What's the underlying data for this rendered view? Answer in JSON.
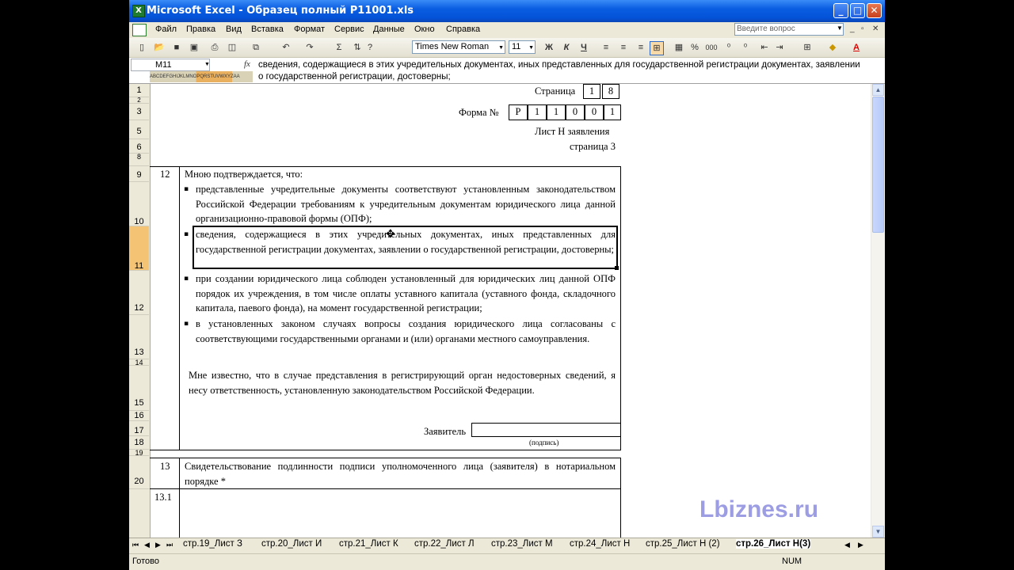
{
  "window": {
    "title": "Microsoft Excel - Образец полный Р11001.xls",
    "app_icon": "excel-icon",
    "controls": [
      "minimize-icon",
      "maximize-icon",
      "close-icon"
    ]
  },
  "menu": {
    "items": [
      "Файл",
      "Правка",
      "Вид",
      "Вставка",
      "Формат",
      "Сервис",
      "Данные",
      "Окно",
      "Справка"
    ],
    "ask_placeholder": "Введите вопрос"
  },
  "toolbar": {
    "font_name": "Times New Roman",
    "font_size": "11",
    "bold": "Ж",
    "italic": "К",
    "underline": "Ч",
    "percent": "%",
    "thousands": "000",
    "sum": "Σ"
  },
  "formula_bar": {
    "cell_ref": "M11",
    "fx": "fx",
    "content": "сведения, содержащиеся в этих учредительных документах, иных представленных для государственной регистрации документах, заявлении о государственной регистрации, достоверны;",
    "column_headers_strip": "ABCDEFGHIJKLMNOPQRSTUVWXYZAA"
  },
  "rows": [
    "1",
    "2",
    "3",
    "5",
    "6",
    "8",
    "9",
    "10",
    "11",
    "12",
    "13",
    "14",
    "15",
    "16",
    "17",
    "18",
    "19",
    "20"
  ],
  "form": {
    "page_label": "Страница",
    "page_digits": [
      "1",
      "8"
    ],
    "form_label": "Форма №",
    "form_digits": [
      "Р",
      "1",
      "1",
      "0",
      "0",
      "1"
    ],
    "sheet_label": "Лист Н заявления",
    "sheet_page": "страница 3",
    "section12": {
      "number": "12",
      "intro": "Мною подтверждается, что:",
      "bullets": [
        "представленные учредительные документы соответствуют установленным законодательством Российской Федерации требованиям к учредительным документам юридического лица данной организационно-правовой формы (ОПФ);",
        "сведения, содержащиеся в этих учредительных документах, иных представленных для государственной регистрации документах, заявлении о государственной регистрации, достоверны;",
        "при создании юридического лица соблюден установленный для юридических лиц данной ОПФ порядок их учреждения, в том числе оплаты уставного капитала (уставного фонда, складочного капитала, паевого фонда), на момент государственной регистрации;",
        "в установленных законом случаях вопросы создания юридического лица согласованы с соответствующими государственными органами и (или) органами местного самоуправления."
      ],
      "responsibility": "Мне известно, что в случае представления в регистрирующий орган недостоверных сведений, я несу ответственность, установленную законодательством Российской Федерации.",
      "applicant_label": "Заявитель",
      "signature_caption": "(подпись)"
    },
    "section13": {
      "number": "13",
      "text": "Свидетельствование подлинности подписи уполномоченного лица (заявителя) в нотариальном порядке *",
      "sub_number": "13.1"
    }
  },
  "watermark": "Lbiznes.ru",
  "tabs": [
    "стр.19_Лист З",
    "стр.20_Лист И",
    "стр.21_Лист К",
    "стр.22_Лист Л",
    "стр.23_Лист М",
    "стр.24_Лист Н",
    "стр.25_Лист Н (2)",
    "стр.26_Лист Н(3)"
  ],
  "active_tab": "стр.26_Лист Н(3)",
  "status": {
    "left": "Готово",
    "num": "NUM"
  }
}
